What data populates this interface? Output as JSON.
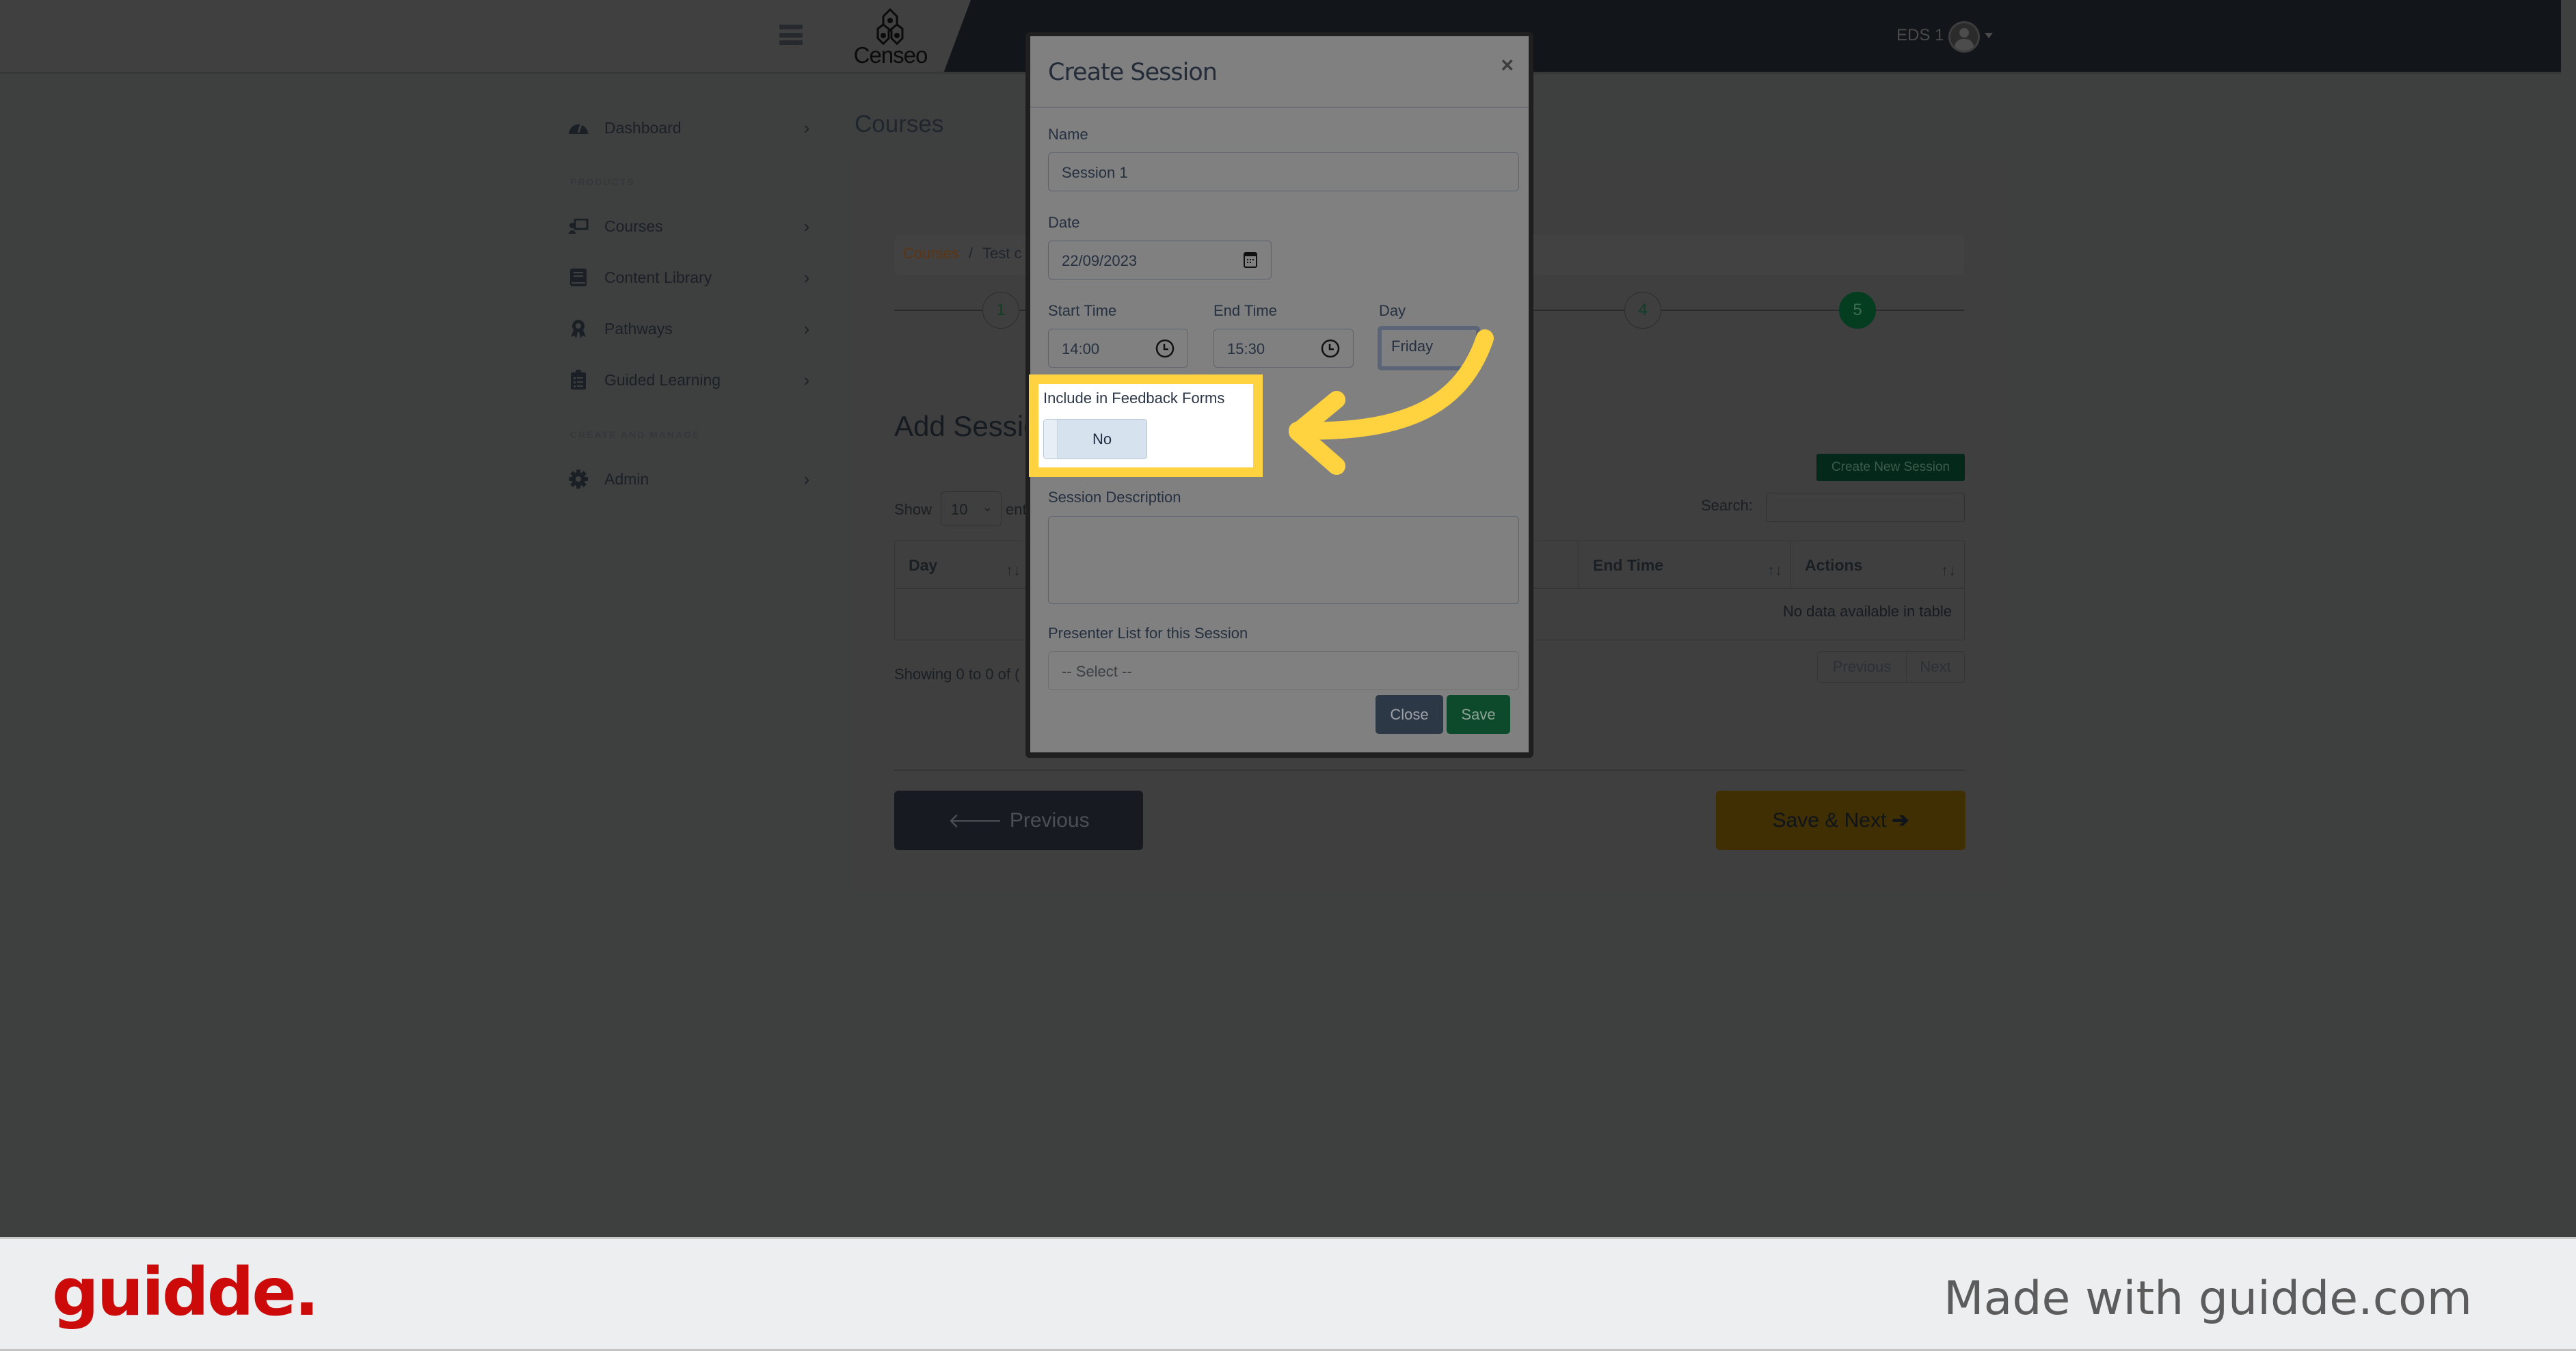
{
  "header": {
    "logo_text": "Censeo",
    "user_name": "EDS 1"
  },
  "sidebar": {
    "items": [
      {
        "label": "Dashboard",
        "icon": "dashboard-icon"
      },
      {
        "label": "Courses",
        "icon": "courses-icon"
      },
      {
        "label": "Content Library",
        "icon": "book-icon"
      },
      {
        "label": "Pathways",
        "icon": "award-icon"
      },
      {
        "label": "Guided Learning",
        "icon": "clipboard-list-icon"
      },
      {
        "label": "Admin",
        "icon": "gear-icon"
      }
    ],
    "sections": {
      "products": "PRODUCTS",
      "create_and_manage": "CREATE AND MANAGE"
    }
  },
  "main": {
    "page_title": "Courses",
    "breadcrumb": {
      "link": "Courses",
      "separator": "/",
      "current": "Test c"
    },
    "steps": [
      "1",
      "4",
      "5"
    ],
    "active_step": "5",
    "section_title": "Add Sessio",
    "create_new_session_label": "Create New Session",
    "show_label": "Show",
    "show_value": "10",
    "entries_label": "ent",
    "search_label": "Search:",
    "table": {
      "columns": [
        "Day",
        "End Time",
        "Actions"
      ],
      "empty_message": "No data available in table"
    },
    "showing_info": "Showing 0 to 0 of (",
    "pagination": {
      "previous": "Previous",
      "next": "Next"
    },
    "previous_button": "Previous",
    "save_next_button": "Save & Next"
  },
  "modal": {
    "title": "Create Session",
    "close_symbol": "×",
    "fields": {
      "name_label": "Name",
      "name_value": "Session 1",
      "date_label": "Date",
      "date_value": "22/09/2023",
      "start_time_label": "Start Time",
      "start_time_value": "14:00",
      "end_time_label": "End Time",
      "end_time_value": "15:30",
      "day_label": "Day",
      "day_value": "Friday",
      "feedback_label": "Include in Feedback Forms",
      "feedback_value": "No",
      "description_label": "Session Description",
      "description_value": "",
      "presenter_label": "Presenter List for this Session",
      "presenter_value": "-- Select --"
    },
    "close_button": "Close",
    "save_button": "Save"
  },
  "annotation": {
    "highlight_color": "#ffd23f"
  },
  "footer": {
    "brand": "guidde.",
    "made_with": "Made with guidde.com",
    "brand_color": "#cc0a0a"
  }
}
